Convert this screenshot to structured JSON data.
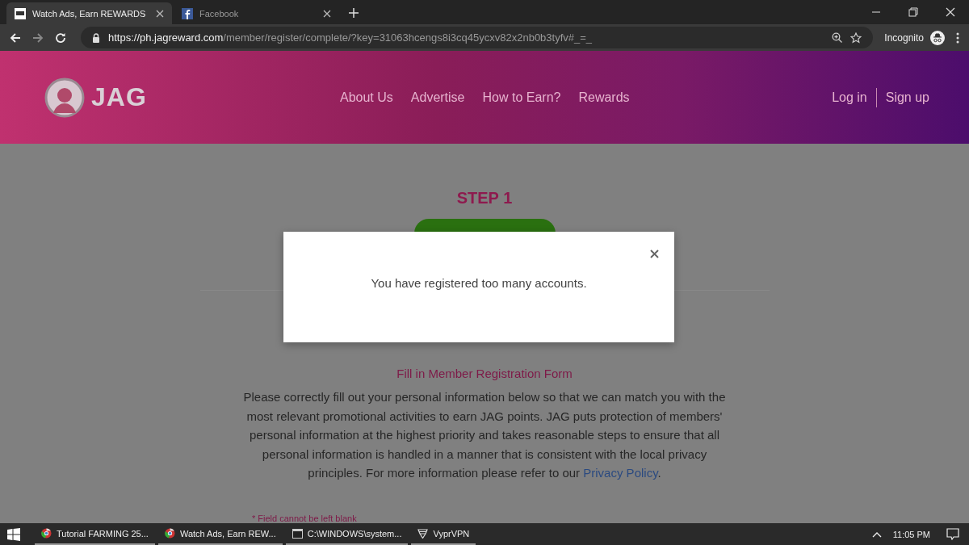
{
  "browser": {
    "tabs": [
      {
        "title": "Watch Ads, Earn REWARDS",
        "kind": "site",
        "selected": true
      },
      {
        "title": "Facebook",
        "kind": "facebook",
        "selected": false
      }
    ],
    "address": {
      "host": "https://ph.jagreward.com",
      "path": "/member/register/complete/?key=31063hcengs8i3cq45ycxv82x2nb0b3tyfv#_=_"
    },
    "profile": "Incognito"
  },
  "site": {
    "logo": "JAG",
    "nav": [
      "About Us",
      "Advertise",
      "How to Earn?",
      "Rewards"
    ],
    "auth": [
      "Log in",
      "Sign up"
    ]
  },
  "page": {
    "step1": "STEP 1",
    "form_title": "Fill in Member Registration Form",
    "intro": "Please correctly fill out your personal information below so that we can match you with the most relevant promotional activities to earn JAG points. JAG puts protection of members' personal information at the highest priority and takes reasonable steps to ensure that all personal information is handled in a manner that is consistent with the local privacy principles. For more information please refer to our",
    "link": "Privacy Policy",
    "intro_end": ".",
    "note": "* Field cannot be left blank"
  },
  "modal": {
    "message": "You have registered too many accounts."
  },
  "taskbar": {
    "apps": [
      {
        "label": "Tutorial FARMING 25...",
        "kind": "browser"
      },
      {
        "label": "Watch Ads, Earn REW...",
        "kind": "browser"
      },
      {
        "label": "C:\\WINDOWS\\system...",
        "kind": "console"
      },
      {
        "label": "VyprVPN",
        "kind": "vpn"
      }
    ],
    "time": "11:05 PM"
  }
}
